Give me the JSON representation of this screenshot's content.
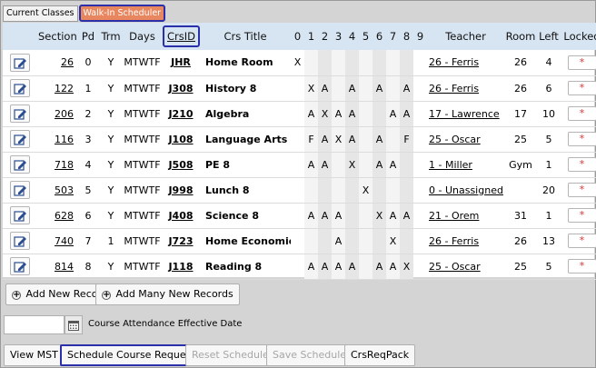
{
  "tabs": [
    {
      "label": "Current Classes"
    },
    {
      "label": "Walk-In Scheduler"
    }
  ],
  "columns": {
    "section": "Section",
    "pd": "Pd",
    "trm": "Trm",
    "days": "Days",
    "crsid": "CrsID",
    "title": "Crs Title",
    "p0": "0",
    "p1": "1",
    "p2": "2",
    "p3": "3",
    "p4": "4",
    "p5": "5",
    "p6": "6",
    "p7": "7",
    "p8": "8",
    "p9": "9",
    "teacher": "Teacher",
    "room": "Room",
    "left": "Left",
    "locked": "Locked"
  },
  "rows": [
    {
      "section": "26",
      "pd": "0",
      "trm": "Y",
      "days": "MTWTF",
      "crsid": "JHR",
      "title": "Home Room",
      "p": [
        "X",
        "",
        "",
        "",
        "",
        "",
        "",
        "",
        "",
        ""
      ],
      "teacher": "26 - Ferris",
      "room": "26",
      "left": "4",
      "locked": "*"
    },
    {
      "section": "122",
      "pd": "1",
      "trm": "Y",
      "days": "MTWTF",
      "crsid": "J308",
      "title": "History 8",
      "p": [
        "",
        "X",
        "A",
        "",
        "A",
        "",
        "A",
        "",
        "A",
        ""
      ],
      "teacher": "26 - Ferris",
      "room": "26",
      "left": "6",
      "locked": "*"
    },
    {
      "section": "206",
      "pd": "2",
      "trm": "Y",
      "days": "MTWTF",
      "crsid": "J210",
      "title": "Algebra",
      "p": [
        "",
        "A",
        "X",
        "A",
        "A",
        "",
        "",
        "A",
        "A",
        ""
      ],
      "teacher": "17 - Lawrence",
      "room": "17",
      "left": "10",
      "locked": "*"
    },
    {
      "section": "116",
      "pd": "3",
      "trm": "Y",
      "days": "MTWTF",
      "crsid": "J108",
      "title": "Language Arts 8",
      "p": [
        "",
        "F",
        "A",
        "X",
        "A",
        "",
        "A",
        "",
        "F",
        ""
      ],
      "teacher": "25 - Oscar",
      "room": "25",
      "left": "5",
      "locked": "*"
    },
    {
      "section": "718",
      "pd": "4",
      "trm": "Y",
      "days": "MTWTF",
      "crsid": "J508",
      "title": "PE 8",
      "p": [
        "",
        "A",
        "A",
        "",
        "X",
        "",
        "A",
        "A",
        "",
        ""
      ],
      "teacher": "1 - Miller",
      "room": "Gym",
      "left": "1",
      "locked": "*"
    },
    {
      "section": "503",
      "pd": "5",
      "trm": "Y",
      "days": "MTWTF",
      "crsid": "J998",
      "title": "Lunch 8",
      "p": [
        "",
        "",
        "",
        "",
        "",
        "X",
        "",
        "",
        "",
        ""
      ],
      "teacher": "0 - Unassigned",
      "room": "",
      "left": "20",
      "locked": "*"
    },
    {
      "section": "628",
      "pd": "6",
      "trm": "Y",
      "days": "MTWTF",
      "crsid": "J408",
      "title": "Science 8",
      "p": [
        "",
        "A",
        "A",
        "A",
        "",
        "",
        "X",
        "A",
        "A",
        ""
      ],
      "teacher": "21 - Orem",
      "room": "31",
      "left": "1",
      "locked": "*"
    },
    {
      "section": "740",
      "pd": "7",
      "trm": "1",
      "days": "MTWTF",
      "crsid": "J723",
      "title": "Home Economics",
      "p": [
        "",
        "",
        "",
        "A",
        "",
        "",
        "",
        "X",
        "",
        ""
      ],
      "teacher": "26 - Ferris",
      "room": "26",
      "left": "13",
      "locked": "*"
    },
    {
      "section": "814",
      "pd": "8",
      "trm": "Y",
      "days": "MTWTF",
      "crsid": "J118",
      "title": "Reading 8",
      "p": [
        "",
        "A",
        "A",
        "A",
        "A",
        "",
        "A",
        "A",
        "X",
        ""
      ],
      "teacher": "25 - Oscar",
      "room": "25",
      "left": "5",
      "locked": "*"
    }
  ],
  "actions": {
    "add_new": "Add New Record",
    "add_many": "Add Many New Records"
  },
  "date": {
    "value": "",
    "label": "Course Attendance Effective Date"
  },
  "footer": {
    "view_mst": "View MST",
    "schedule_requests": "Schedule Course Requests",
    "reset": "Reset Schedule",
    "save": "Save Schedule",
    "crsreqpack": "CrsReqPack"
  },
  "colors": {
    "header_bg": "#d7e4f1",
    "highlight_border": "#2b2fa8",
    "walkin_tab": "#e8875f"
  }
}
